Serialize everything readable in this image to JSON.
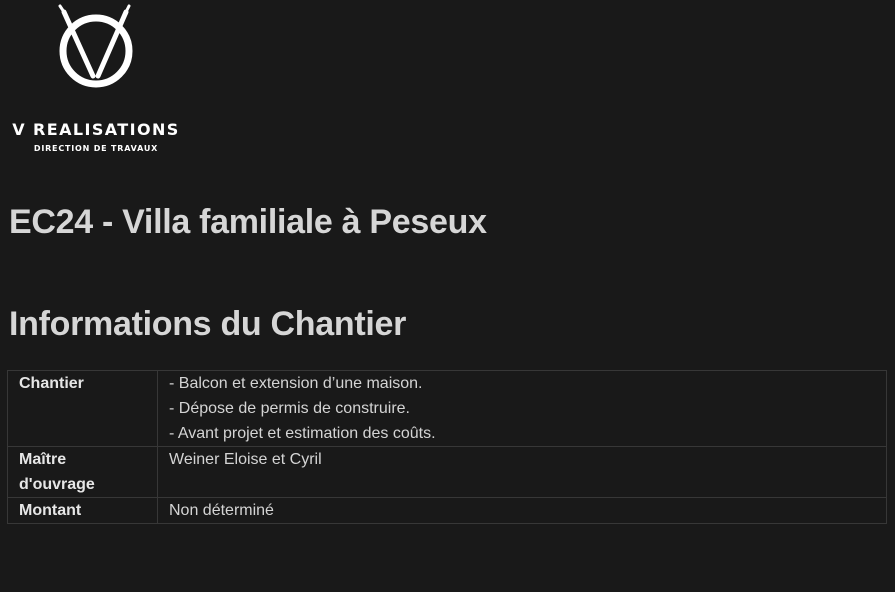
{
  "logo": {
    "brand_name": "V REALISATIONS",
    "tagline": "DIRECTION DE TRAVAUX",
    "mark_letter": "V"
  },
  "page": {
    "title": "EC24 - Villa familiale à Peseux"
  },
  "section": {
    "title": "Informations du Chantier"
  },
  "info_table": {
    "rows": [
      {
        "label": "Chantier",
        "lines": [
          "- Balcon et extension d’une maison.",
          "- Dépose de permis de construire.",
          "- Avant projet et estimation des coûts."
        ]
      },
      {
        "label_lines": [
          "Maître",
          "d'ouvrage"
        ],
        "value": "Weiner Eloise et Cyril"
      },
      {
        "label": "Montant",
        "value": "Non déterminé"
      }
    ]
  },
  "colors": {
    "background": "#191919",
    "text": "#d4d4d4",
    "border": "#373737",
    "logo": "#ffffff"
  }
}
